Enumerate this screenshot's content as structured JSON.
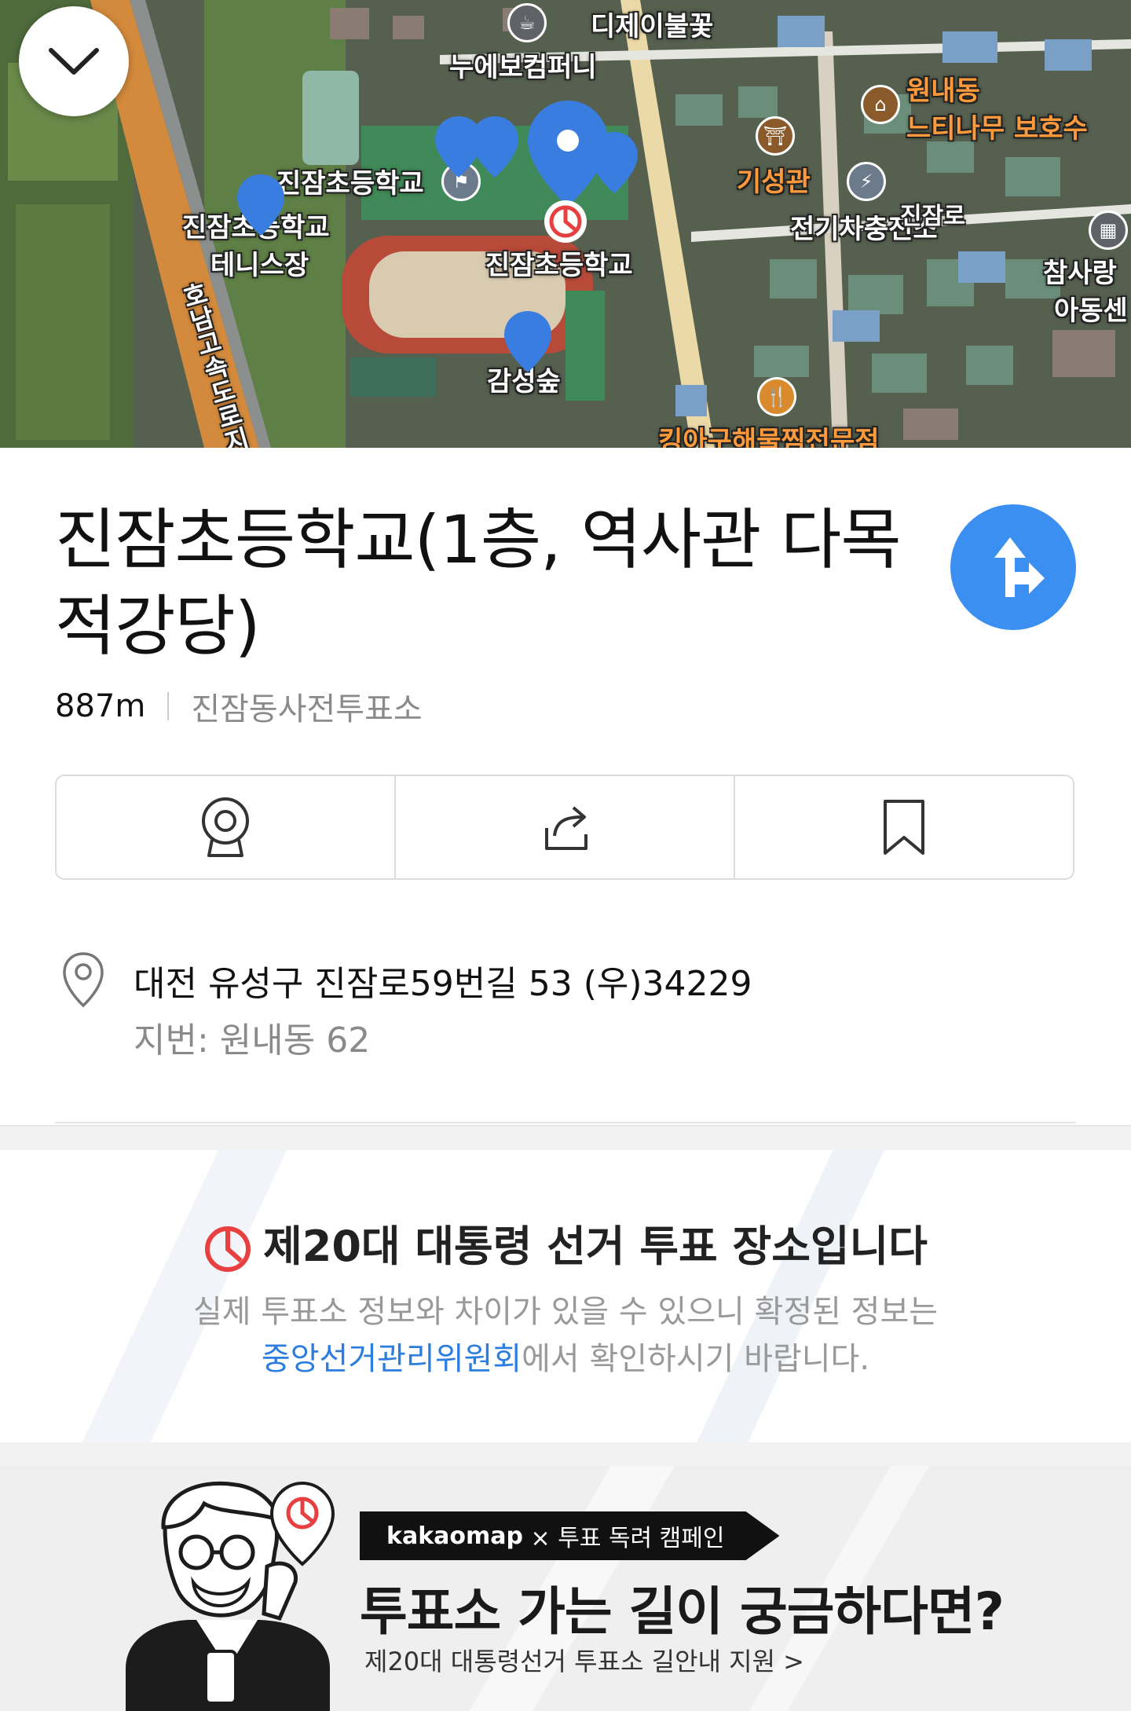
{
  "map": {
    "labels": {
      "dijei": "디제이불꽃",
      "nuebo": "누에보컴퍼니",
      "wonnae": "원내동",
      "neutinamu": "느티나무 보호수",
      "school_top": "진잠초등학교",
      "school_tennis": "진잠초등학교",
      "tennis": "테니스장",
      "school_main": "진잠초등학교",
      "giseong": "기성관",
      "charger": "전기차충전소",
      "road_right": "진잠로",
      "chamsarang": "참사랑",
      "adong": "아동센",
      "gamseong": "감성숲",
      "highway": "호남고속도로지",
      "restaurant": "킹아구해물찜전문점"
    },
    "collapse_icon": "chevron-down-icon"
  },
  "place": {
    "title": "진잠초등학교(1층, 역사관 다목적강당)",
    "distance": "887m",
    "category": "진잠동사전투표소",
    "directions_icon": "directions-arrow-icon"
  },
  "actions": [
    {
      "icon": "roadview-camera-icon"
    },
    {
      "icon": "share-icon"
    },
    {
      "icon": "bookmark-icon"
    }
  ],
  "address": {
    "road": "대전 유성구 진잠로59번길 53 (우)34229",
    "jibun": "지번: 원내동 62"
  },
  "vote_notice": {
    "heading": "제20대 대통령 선거 투표 장소입니다",
    "desc_line1": "실제 투표소 정보와 차이가 있을 수 있으니 확정된 정보는",
    "link": "중앙선거관리위원회",
    "desc_line2_rest": "에서 확인하시기 바랍니다."
  },
  "banner": {
    "brand": "kakaomap",
    "tag_rest": "× 투표 독려 캠페인",
    "title": "투표소 가는 길이 궁금하다면?",
    "sub": "제20대 대통령선거 투표소 길안내 지원 >"
  },
  "colors": {
    "accent": "#3a8ff0",
    "link": "#2c7de0",
    "vote_red": "#e84040"
  }
}
